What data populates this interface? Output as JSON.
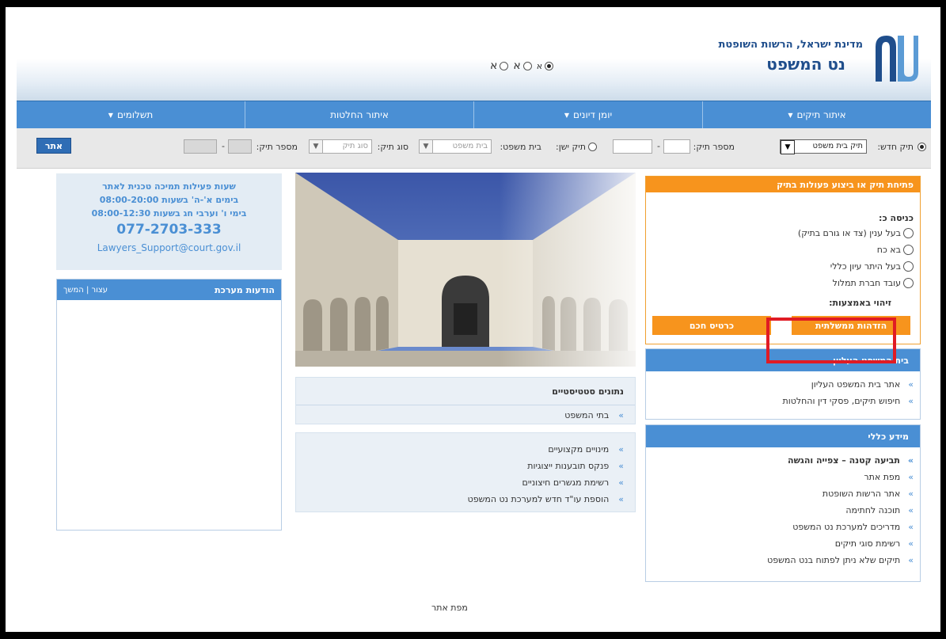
{
  "header": {
    "org_line": "מדינת ישראל, הרשות השופטת",
    "site_title": "נט המשפט",
    "languages": [
      {
        "label": "א",
        "selected": true
      },
      {
        "label": "א",
        "selected": false
      },
      {
        "label": "א",
        "selected": false
      }
    ]
  },
  "nav": {
    "items": [
      {
        "label": "איתור תיקים",
        "has_dropdown": true
      },
      {
        "label": "יומן דיונים",
        "has_dropdown": true
      },
      {
        "label": "איתור החלטות",
        "has_dropdown": false
      },
      {
        "label": "תשלומים",
        "has_dropdown": true
      }
    ],
    "dropdown_glyph": "▼"
  },
  "search": {
    "new_case_label": "תיק חדש:",
    "court_case_select": "תיק בית משפט",
    "case_number_label": "מספר תיק:",
    "dash": "-",
    "old_case_label": "תיק ישן:",
    "court_label": "בית משפט:",
    "court_select_placeholder": "בית משפט",
    "case_type_label": "סוג תיק:",
    "case_type_placeholder": "סוג תיק",
    "case_number_label2": "מספר תיק:",
    "go_button": "אתר"
  },
  "login_panel": {
    "title": "פתיחת תיק או ביצוע פעולות בתיק",
    "login_as": "כניסה כ:",
    "roles": [
      "בעל ענין (צד או גורם בתיק)",
      "בא כח",
      "בעל היתר עיון כללי",
      "עובד חברת תמלול"
    ],
    "identify_by": "זיהוי באמצעות:",
    "gov_id_button": "הזדהות ממשלתית",
    "smart_card_button": "כרטיס חכם"
  },
  "supreme_court_panel": {
    "title": "בית המשפט העליון",
    "links": [
      "אתר בית המשפט העליון",
      "חיפוש תיקים, פסקי דין והחלטות"
    ]
  },
  "general_info_panel": {
    "title": "מידע כללי",
    "links": [
      {
        "label": "תביעה קטנה – צפייה והגשה",
        "bold": true
      },
      {
        "label": "מפת אתר",
        "bold": false
      },
      {
        "label": "אתר הרשות השופטת",
        "bold": false
      },
      {
        "label": "תוכנה לחתימה",
        "bold": false
      },
      {
        "label": "מדריכים למערכת נט המשפט",
        "bold": false
      },
      {
        "label": "רשימת סוגי תיקים",
        "bold": false
      },
      {
        "label": "תיקים שלא ניתן לפתוח בנט המשפט",
        "bold": false
      }
    ]
  },
  "statistics_panel": {
    "title": "נתונים סטטיסטיים",
    "links": [
      "בתי המשפט"
    ]
  },
  "misc_panel": {
    "links": [
      "מינויים מקצועיים",
      "פנקס תובענות ייצוגיות",
      "רשימת מגשרים חיצוניים",
      "הוספת עו\"ד חדש למערכת נט המשפט"
    ]
  },
  "support_box": {
    "line1": "שעות פעילות תמיכה טכנית לאתר",
    "line2": "בימים א'-ה' בשעות 08:00-20:00",
    "line3": "בימי ו' וערבי חג בשעות 08:00-12:30",
    "phone": "077-2703-333",
    "email": "Lawyers_Support@court.gov.il"
  },
  "system_messages": {
    "title": "הודעות מערכת",
    "controls": "עצור | המשך"
  },
  "footer": {
    "sitemap": "מפת אתר"
  },
  "colors": {
    "nav_blue": "#4a8fd4",
    "orange": "#f7941d",
    "highlight_red": "#e01b24"
  }
}
